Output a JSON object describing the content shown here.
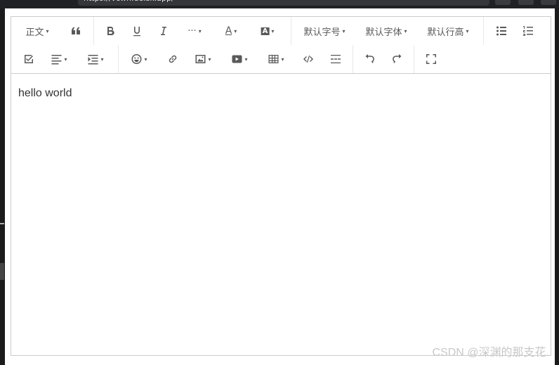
{
  "browser": {
    "url": "https://vcwh.de.sk.app/"
  },
  "toolbar": {
    "row1": [
      {
        "id": "header",
        "label": "正文",
        "dropdown": true
      },
      {
        "id": "blockquote",
        "icon": "quote-icon"
      },
      {
        "id": "bold",
        "icon": "bold-icon"
      },
      {
        "id": "underline",
        "icon": "underline-icon"
      },
      {
        "id": "italic",
        "icon": "italic-icon"
      },
      {
        "id": "more",
        "label": "···",
        "dropdown": true
      },
      {
        "id": "color",
        "icon": "font-color-icon",
        "dropdown": true
      },
      {
        "id": "bgcolor",
        "icon": "bg-color-icon",
        "dropdown": true
      },
      {
        "id": "fontsize",
        "label": "默认字号",
        "dropdown": true
      },
      {
        "id": "fontfamily",
        "label": "默认字体",
        "dropdown": true
      },
      {
        "id": "lineheight",
        "label": "默认行高",
        "dropdown": true
      },
      {
        "id": "bulleted-list",
        "icon": "bulleted-list-icon"
      },
      {
        "id": "numbered-list",
        "icon": "numbered-list-icon"
      }
    ],
    "row2": [
      {
        "id": "todo",
        "icon": "checkbox-icon"
      },
      {
        "id": "justify",
        "icon": "align-left-icon",
        "dropdown": true
      },
      {
        "id": "indent",
        "icon": "indent-icon",
        "dropdown": true
      },
      {
        "id": "emotion",
        "icon": "emoji-icon",
        "dropdown": true
      },
      {
        "id": "link",
        "icon": "link-icon"
      },
      {
        "id": "image",
        "icon": "image-icon",
        "dropdown": true
      },
      {
        "id": "video",
        "icon": "video-icon",
        "dropdown": true
      },
      {
        "id": "table",
        "icon": "table-icon",
        "dropdown": true
      },
      {
        "id": "code",
        "icon": "code-icon"
      },
      {
        "id": "divider",
        "icon": "divider-icon"
      },
      {
        "id": "undo",
        "icon": "undo-icon"
      },
      {
        "id": "redo",
        "icon": "redo-icon"
      },
      {
        "id": "fullscreen",
        "icon": "fullscreen-icon"
      }
    ],
    "caret": "▾",
    "labels": {
      "header": "正文",
      "more": "···",
      "fontsize": "默认字号",
      "fontfamily": "默认字体",
      "lineheight": "默认行高",
      "font_letter": "A"
    }
  },
  "content": {
    "text": "hello world"
  },
  "watermark": "CSDN @深渊的那支花."
}
